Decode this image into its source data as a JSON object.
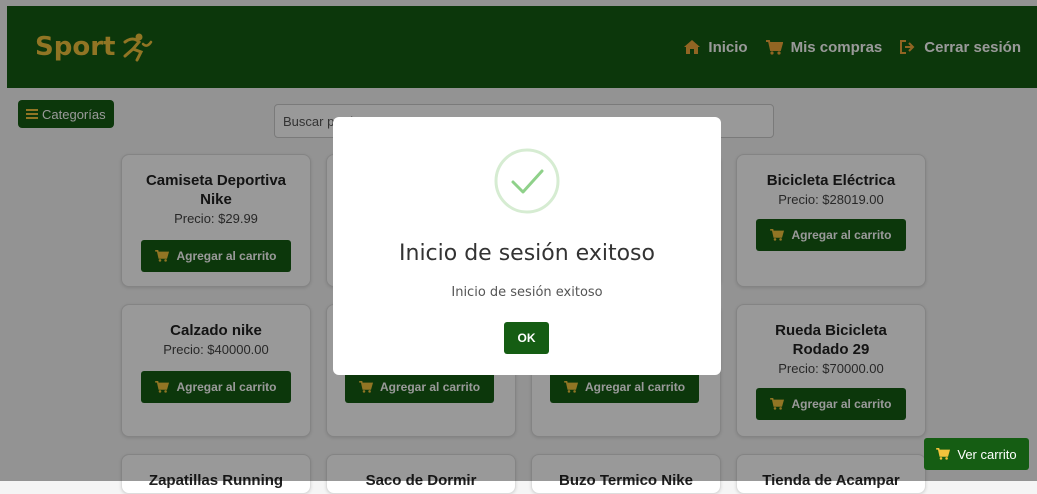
{
  "brand": {
    "name": "Sport"
  },
  "nav": {
    "home": "Inicio",
    "purchases": "Mis compras",
    "logout": "Cerrar sesión"
  },
  "toolbar": {
    "categories": "Categorías"
  },
  "search": {
    "placeholder": "Buscar productos..."
  },
  "products": [
    {
      "name": "Camiseta Deportiva Nike",
      "price": "Precio: $29.99",
      "action": "Agregar al carrito"
    },
    {
      "name": "",
      "price": "",
      "action": ""
    },
    {
      "name": "",
      "price": "",
      "action": ""
    },
    {
      "name": "Bicicleta Eléctrica",
      "price": "Precio: $28019.00",
      "action": "Agregar al carrito"
    },
    {
      "name": "Calzado nike",
      "price": "Precio: $40000.00",
      "action": "Agregar al carrito"
    },
    {
      "name": "",
      "price": "",
      "action": "Agregar al carrito"
    },
    {
      "name": "",
      "price": "",
      "action": "Agregar al carrito"
    },
    {
      "name": "Rueda Bicicleta Rodado 29",
      "price": "Precio: $70000.00",
      "action": "Agregar al carrito"
    },
    {
      "name": "Zapatillas Running"
    },
    {
      "name": "Saco de Dormir"
    },
    {
      "name": "Buzo Termico Nike"
    },
    {
      "name": "Tienda de Acampar"
    }
  ],
  "modal": {
    "title": "Inicio de sesión exitoso",
    "text": "Inicio de sesión exitoso",
    "ok": "OK",
    "icon": "success-check-icon"
  },
  "cart": {
    "view": "Ver carrito"
  },
  "colors": {
    "primary": "#155d13",
    "brand_text": "#f2c33c",
    "nav_icon": "#f2a93b"
  }
}
